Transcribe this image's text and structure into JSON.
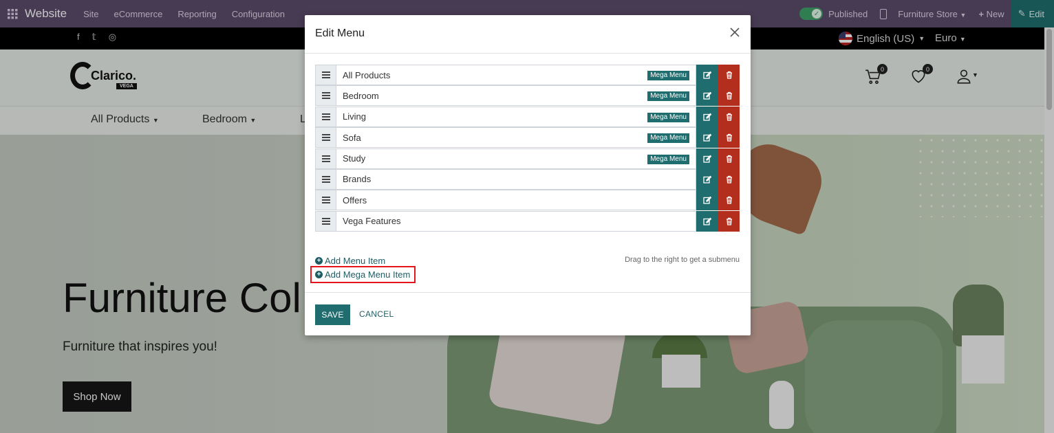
{
  "topbar": {
    "brand": "Website",
    "menus": [
      "Site",
      "eCommerce",
      "Reporting",
      "Configuration"
    ],
    "published": "Published",
    "store": "Furniture Store",
    "new": "New",
    "edit": "Edit"
  },
  "socialbar": {
    "language": "English (US)",
    "currency": "Euro"
  },
  "header": {
    "logo_text": "Clarico.",
    "logo_sub": "VEGA",
    "cart_count": "0",
    "wishlist_count": "0"
  },
  "nav": {
    "items": [
      "All Products",
      "Bedroom",
      "L"
    ]
  },
  "hero": {
    "title": "Furniture Col",
    "subtitle": "Furniture that inspires you!",
    "cta": "Shop Now"
  },
  "modal": {
    "title": "Edit Menu",
    "items": [
      {
        "label": "All Products",
        "badge": "Mega Menu"
      },
      {
        "label": "Bedroom",
        "badge": "Mega Menu"
      },
      {
        "label": "Living",
        "badge": "Mega Menu"
      },
      {
        "label": "Sofa",
        "badge": "Mega Menu"
      },
      {
        "label": "Study",
        "badge": "Mega Menu"
      },
      {
        "label": "Brands",
        "badge": ""
      },
      {
        "label": "Offers",
        "badge": ""
      },
      {
        "label": "Vega Features",
        "badge": ""
      }
    ],
    "add_menu_item": "Add Menu Item",
    "add_mega_menu_item": "Add Mega Menu Item",
    "drag_hint": "Drag to the right to get a submenu",
    "save": "SAVE",
    "cancel": "CANCEL"
  },
  "colors": {
    "topbar": "#5c4b6b",
    "accent": "#1f6d6e",
    "danger": "#b42e1d",
    "highlight": "#e5141a"
  }
}
